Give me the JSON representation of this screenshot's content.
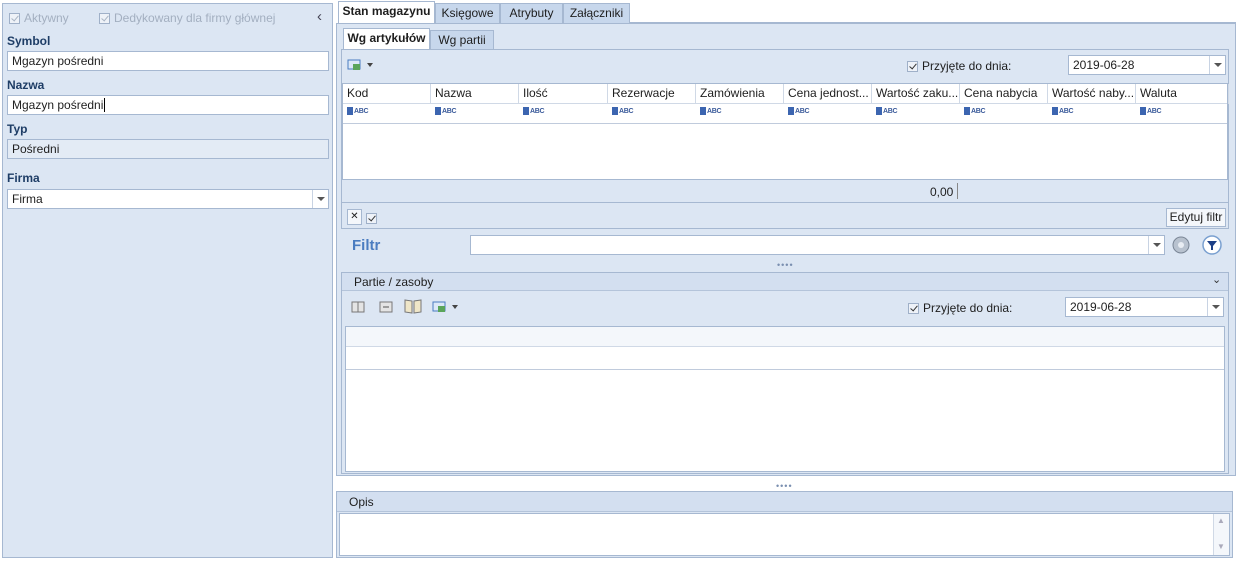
{
  "left": {
    "active_label": "Aktywny",
    "dedicated_label": "Dedykowany dla firmy głównej",
    "collapse_glyph": "‹",
    "symbol_label": "Symbol",
    "symbol_value": "Mgazyn pośredni",
    "name_label": "Nazwa",
    "name_value": "Mgazyn pośredni",
    "type_label": "Typ",
    "type_value": "Pośredni",
    "company_label": "Firma",
    "company_value": "Firma"
  },
  "tabs": [
    "Stan magazynu",
    "Księgowe",
    "Atrybuty",
    "Załączniki"
  ],
  "subtabs": [
    "Wg artykułów",
    "Wg partii"
  ],
  "top": {
    "received_label": "Przyjęte do dnia:",
    "received_checked": true,
    "date": "2019-06-28",
    "columns": [
      "Kod",
      "Nazwa",
      "Ilość",
      "Rezerwacje",
      "Zamówienia",
      "Cena jednost...",
      "Wartość zaku...",
      "Cena nabycia",
      "Wartość naby...",
      "Waluta"
    ],
    "filter_row_glyph": "ABC",
    "total": "0,00",
    "edit_filter": "Edytuj filtr",
    "filter_label": "Filtr",
    "filter_value": ""
  },
  "batches": {
    "title": "Partie / zasoby",
    "received_label": "Przyjęte do dnia:",
    "received_checked": true,
    "date": "2019-06-28"
  },
  "description": {
    "label": "Opis",
    "value": ""
  },
  "colors": {
    "panel": "#dce6f3",
    "border": "#a6b8d1",
    "label": "#1e3d66",
    "filter_label": "#4a7cc0"
  }
}
